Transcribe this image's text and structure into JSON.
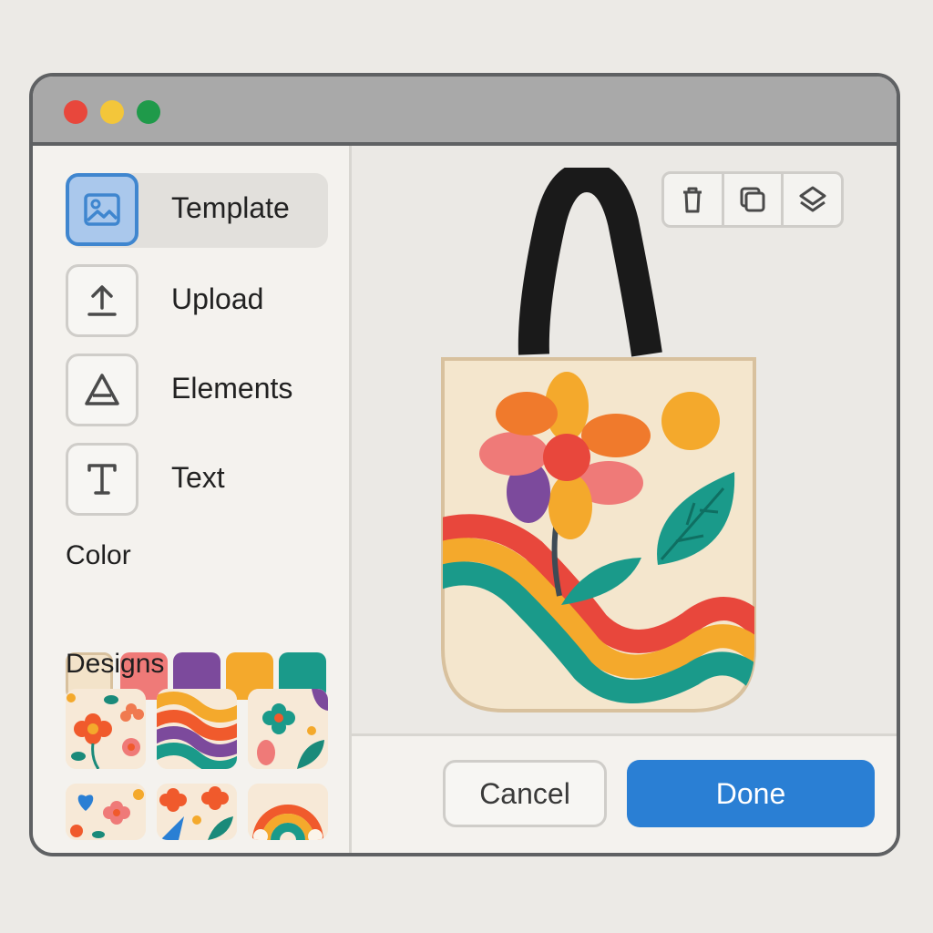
{
  "sidebar": {
    "items": [
      {
        "label": "Template",
        "icon": "image-icon",
        "active": true
      },
      {
        "label": "Upload",
        "icon": "upload-icon",
        "active": false
      },
      {
        "label": "Elements",
        "icon": "triangle-icon",
        "active": false
      },
      {
        "label": "Text",
        "icon": "text-icon",
        "active": false
      }
    ],
    "color_title": "Color",
    "colors": [
      "#f3e3c9",
      "#ef7a78",
      "#7c4a9c",
      "#f4a92c",
      "#1a9a8a"
    ],
    "designs_title": "Designs"
  },
  "toolbar": {
    "icons": [
      "trash-icon",
      "duplicate-icon",
      "layers-icon"
    ]
  },
  "footer": {
    "cancel_label": "Cancel",
    "done_label": "Done"
  },
  "colors": {
    "accent": "#2a7fd4",
    "titlebar": "#a9a9a9",
    "dot_red": "#e8473c",
    "dot_yellow": "#f3c63a",
    "dot_green": "#1f9a4a"
  }
}
